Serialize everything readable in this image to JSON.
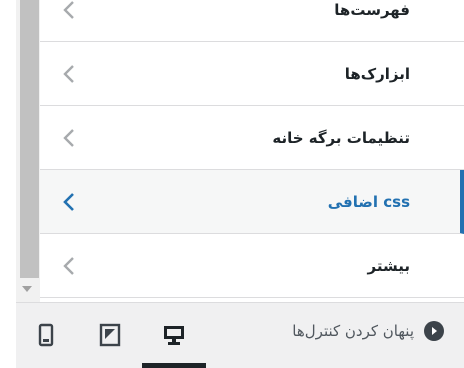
{
  "menu": {
    "items": [
      {
        "label": "فهرست‌ها",
        "active": false
      },
      {
        "label": "ابزارک‌ها",
        "active": false
      },
      {
        "label": "تنظیمات برگه خانه",
        "active": false
      },
      {
        "label": "css اضافی",
        "active": true
      },
      {
        "label": "بیشتر",
        "active": false
      }
    ]
  },
  "footer": {
    "collapse_label": "پنهان کردن کنترل‌ها",
    "devices": [
      {
        "name": "desktop",
        "active": true
      },
      {
        "name": "tablet",
        "active": false
      },
      {
        "name": "mobile",
        "active": false
      }
    ]
  },
  "colors": {
    "accent": "#2271b1",
    "text": "#1d2327",
    "border": "#dcdcde",
    "footer_bg": "#f0f0f1"
  }
}
